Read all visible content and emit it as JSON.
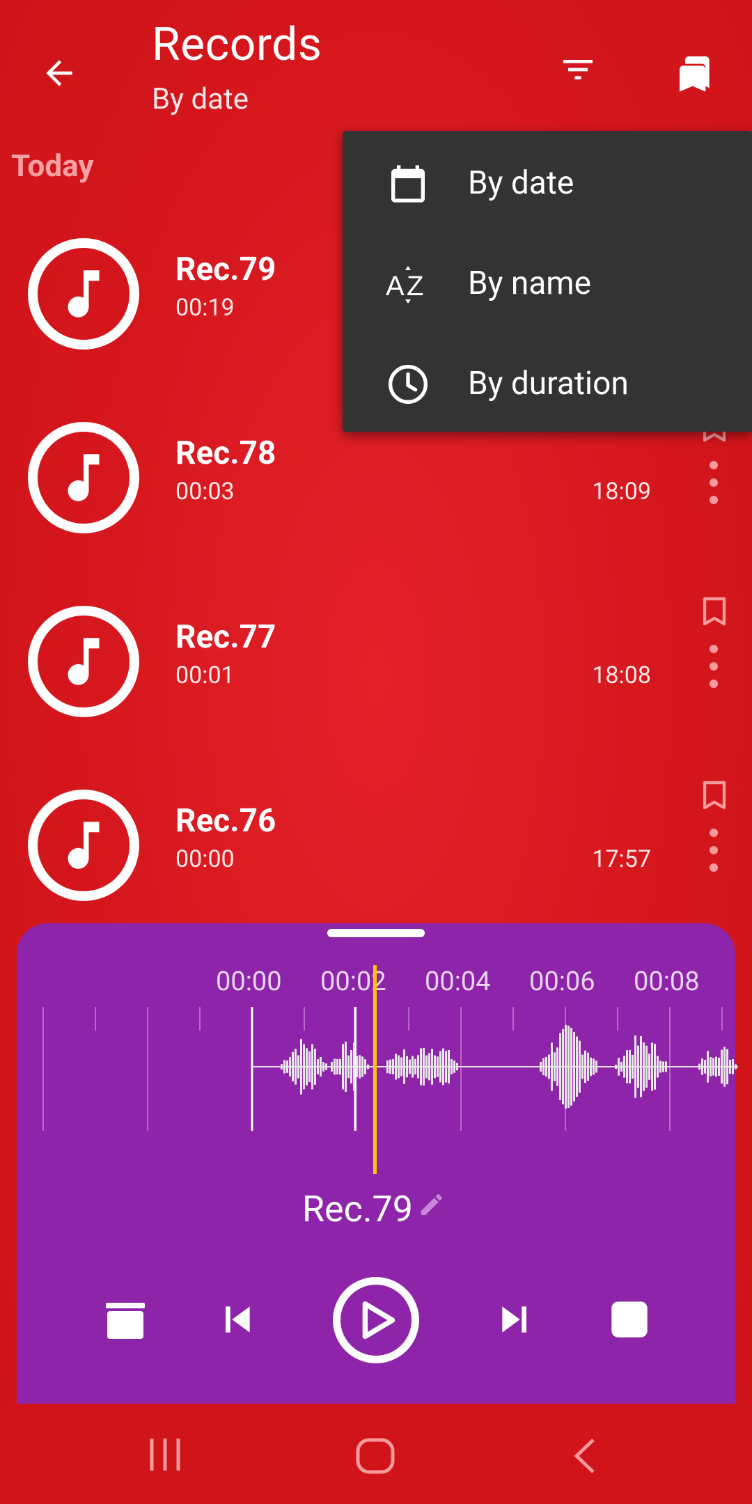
{
  "header": {
    "title": "Records",
    "subtitle": "By date"
  },
  "section": "Today",
  "records": [
    {
      "name": "Rec.79",
      "duration": "00:19",
      "time": ""
    },
    {
      "name": "Rec.78",
      "duration": "00:03",
      "time": "18:09"
    },
    {
      "name": "Rec.77",
      "duration": "00:01",
      "time": "18:08"
    },
    {
      "name": "Rec.76",
      "duration": "00:00",
      "time": "17:57"
    }
  ],
  "sort_menu": {
    "items": [
      {
        "label": "By date",
        "icon": "calendar-icon"
      },
      {
        "label": "By name",
        "icon": "az-sort-icon"
      },
      {
        "label": "By duration",
        "icon": "clock-icon"
      }
    ]
  },
  "player": {
    "timeline": [
      "00:00",
      "00:02",
      "00:04",
      "00:06",
      "00:08"
    ],
    "track_name": "Rec.79",
    "controls": [
      "delete-icon",
      "skip-previous-icon",
      "play-icon",
      "skip-next-icon",
      "stop-icon"
    ]
  },
  "colors": {
    "background": "#d4161c",
    "player": "#8e24aa",
    "menu": "#333333",
    "playhead": "#ffc107",
    "section": "#f7a0a2"
  }
}
